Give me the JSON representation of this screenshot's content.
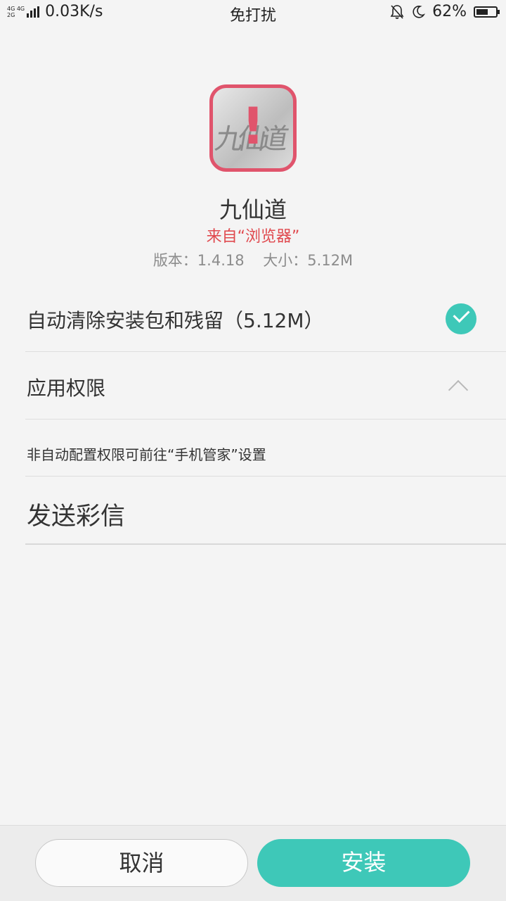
{
  "status_bar": {
    "network_types": [
      "4G 4G",
      "2G"
    ],
    "net_speed": "0.03K/s",
    "mode": "免打扰",
    "bell_icon": "bell-muted-icon",
    "moon_icon": "moon-icon",
    "battery_text": "62%",
    "battery_level": 0.62
  },
  "app": {
    "icon": "warning-icon",
    "name": "九仙道",
    "source": "来自“浏览器”",
    "version": "版本：1.4.18",
    "size": "大小：5.12M"
  },
  "options": {
    "auto_clean_label": "自动清除安装包和残留（5.12M）",
    "auto_clean_checked": true,
    "permissions_label": "应用权限",
    "permissions_hint": "非自动配置权限可前往“手机管家”设置",
    "permission_items": [
      "发送彩信"
    ]
  },
  "actions": {
    "cancel_label": "取消",
    "install_label": "安装"
  },
  "colors": {
    "accent": "#3ec8b8",
    "warning": "#e0546c",
    "source_text": "#e0494e"
  }
}
